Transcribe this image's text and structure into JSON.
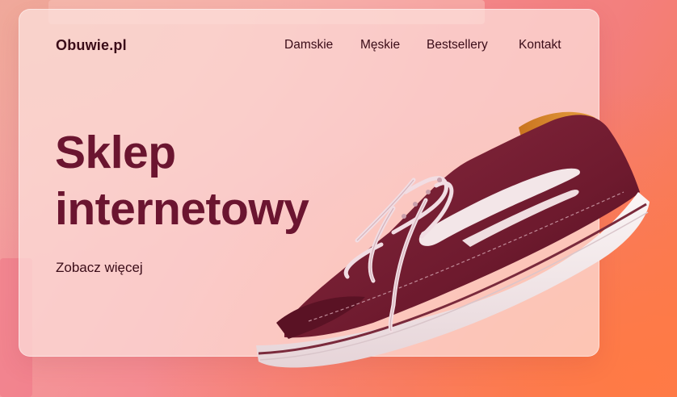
{
  "header": {
    "logo": "Obuwie.pl",
    "nav": [
      "Damskie",
      "Męskie",
      "Bestsellery",
      "Kontakt"
    ]
  },
  "hero": {
    "title_line1": "Sklep",
    "title_line2": "internetowy",
    "cta": "Zobacz więcej"
  },
  "colors": {
    "title": "#6b1530",
    "text": "#3a0c18",
    "shoe_canvas": "#6e1a2e",
    "sole": "#f6eef0",
    "background_warm": "#f9784b",
    "background_pink": "#f58c92"
  },
  "image": {
    "subject": "shoe-image"
  }
}
